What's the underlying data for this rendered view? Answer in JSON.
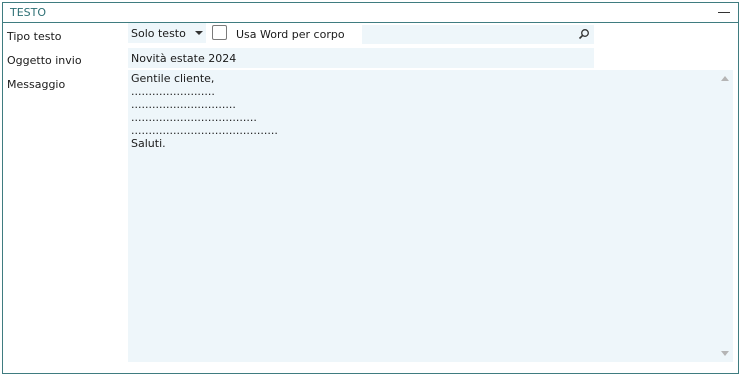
{
  "panel": {
    "title": "TESTO"
  },
  "fields": {
    "tipo_testo": {
      "label": "Tipo testo",
      "value": "Solo testo"
    },
    "usa_word": {
      "label": "Usa Word per corpo",
      "checked": false
    },
    "search": {
      "value": ""
    },
    "oggetto": {
      "label": "Oggetto invio",
      "value": "Novità estate 2024"
    },
    "messaggio": {
      "label": "Messaggio",
      "lines": [
        "Gentile cliente,",
        "........................",
        "..............................",
        "....................................",
        "..........................................",
        "Saluti."
      ]
    }
  },
  "colors": {
    "border": "#3f7c80",
    "title": "#2d6f74",
    "field_bg": "#eef6fa"
  },
  "icons": {
    "collapse": "minus-icon",
    "search": "search-icon"
  }
}
